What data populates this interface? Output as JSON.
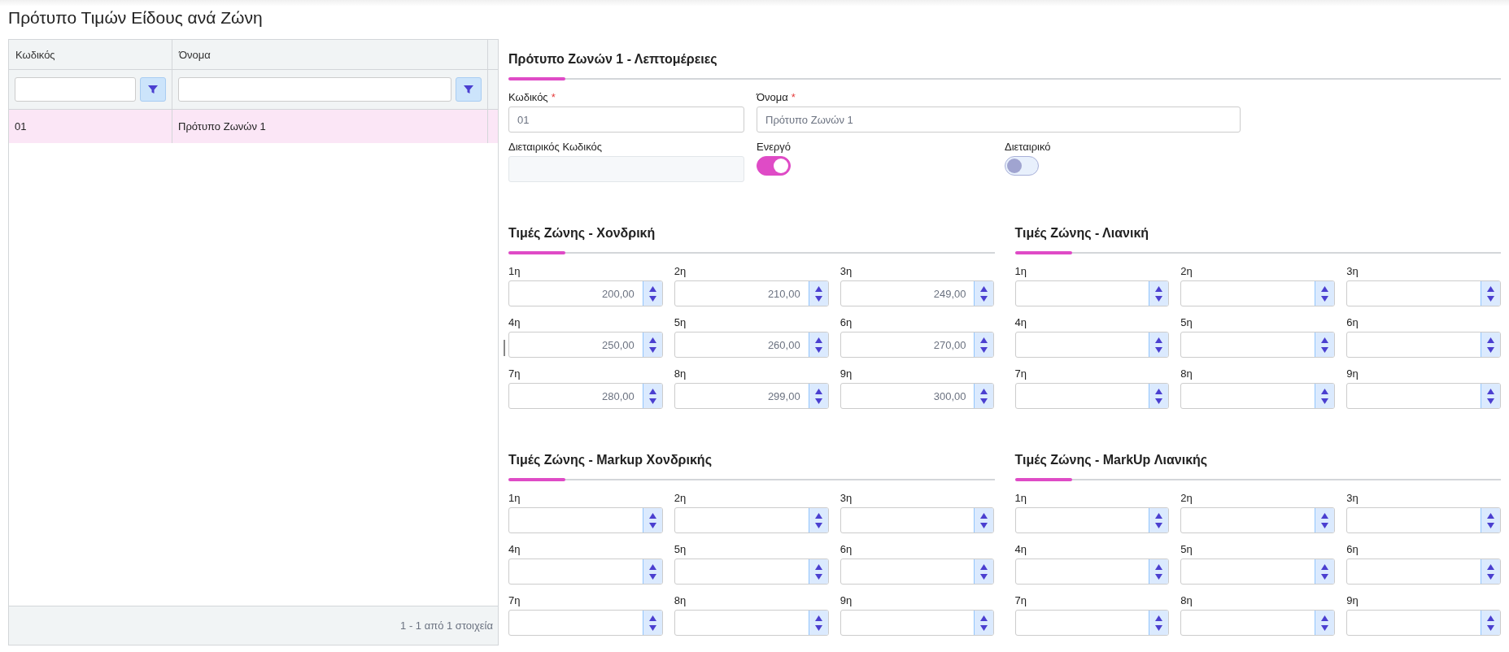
{
  "page": {
    "title": "Πρότυπο Τιμών Είδους ανά Ζώνη"
  },
  "grid": {
    "columns": [
      {
        "label": "Κωδικός"
      },
      {
        "label": "Όνομα"
      }
    ],
    "rows": [
      {
        "cells": [
          "01",
          "Πρότυπο Ζωνών 1"
        ],
        "selected": true
      }
    ],
    "pager": "1 - 1 από 1 στοιχεία"
  },
  "details": {
    "title": "Πρότυπο Ζωνών 1 - Λεπτομέρειες",
    "fields": [
      {
        "kind": "text",
        "label": "Κωδικός",
        "mark": "*",
        "value": "01",
        "disabled": false
      },
      {
        "kind": "text",
        "label": "Όνομα",
        "mark": "*",
        "value": "Πρότυπο Ζωνών 1",
        "disabled": false
      },
      {
        "kind": "text",
        "label": "Διεταιρικός Κωδικός",
        "disabled": true
      },
      {
        "kind": "toggle",
        "label": "Ενεργό",
        "on": true
      },
      {
        "kind": "toggle",
        "label": "Διεταιρικό",
        "on": false
      }
    ]
  },
  "sections": [
    {
      "title": "Τιμές Ζώνης - Χονδρική",
      "fields": [
        {
          "label": "1η",
          "value": "200,00"
        },
        {
          "label": "2η",
          "value": "210,00"
        },
        {
          "label": "3η",
          "value": "249,00"
        },
        {
          "label": "4η",
          "value": "250,00"
        },
        {
          "label": "5η",
          "value": "260,00"
        },
        {
          "label": "6η",
          "value": "270,00"
        },
        {
          "label": "7η",
          "value": "280,00"
        },
        {
          "label": "8η",
          "value": "299,00"
        },
        {
          "label": "9η",
          "value": "300,00"
        }
      ]
    },
    {
      "title": "Τιμές Ζώνης - Λιανική",
      "fields": [
        {
          "label": "1η"
        },
        {
          "label": "2η"
        },
        {
          "label": "3η"
        },
        {
          "label": "4η"
        },
        {
          "label": "5η"
        },
        {
          "label": "6η"
        },
        {
          "label": "7η"
        },
        {
          "label": "8η"
        },
        {
          "label": "9η"
        }
      ]
    },
    {
      "title": "Τιμές Ζώνης - Markup Χονδρικής",
      "fields": [
        {
          "label": "1η"
        },
        {
          "label": "2η"
        },
        {
          "label": "3η"
        },
        {
          "label": "4η"
        },
        {
          "label": "5η"
        },
        {
          "label": "6η"
        },
        {
          "label": "7η"
        },
        {
          "label": "8η"
        },
        {
          "label": "9η"
        }
      ]
    },
    {
      "title": "Τιμές Ζώνης - MarkUp Λιανικής",
      "fields": [
        {
          "label": "1η"
        },
        {
          "label": "2η"
        },
        {
          "label": "3η"
        },
        {
          "label": "4η"
        },
        {
          "label": "5η"
        },
        {
          "label": "6η"
        },
        {
          "label": "7η"
        },
        {
          "label": "8η"
        },
        {
          "label": "9η"
        }
      ]
    }
  ]
}
